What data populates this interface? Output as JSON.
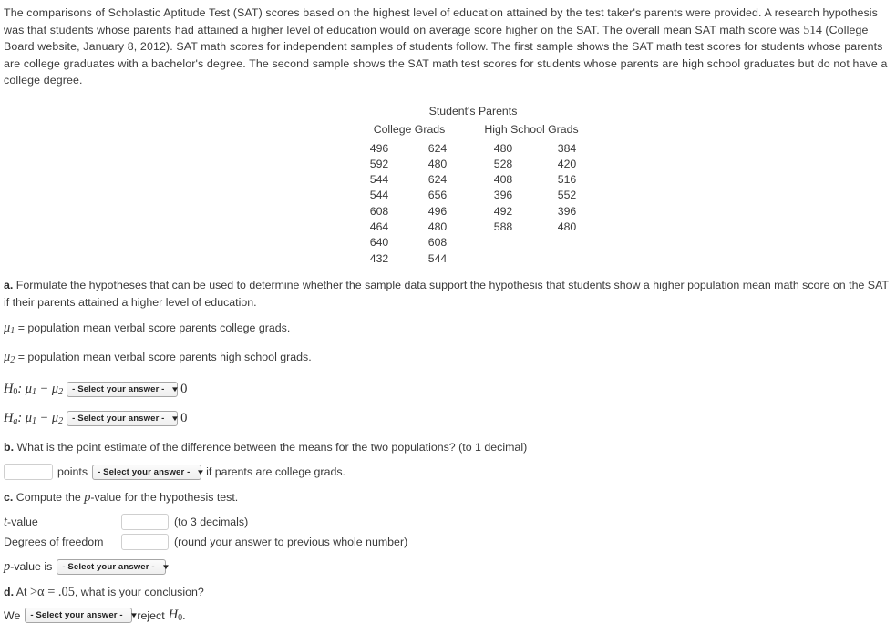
{
  "intro": {
    "part1": "The comparisons of Scholastic Aptitude Test (SAT) scores based on the highest level of education attained by the test taker's parents were provided. A research hypothesis was that students whose parents had attained a higher level of education would on average score higher on the SAT. The overall mean SAT math score was ",
    "mean_score": "514",
    "part2": " (College Board website, January 8, 2012). SAT math scores for independent samples of students follow. The first sample shows the SAT math test scores for students whose parents are college graduates with a bachelor's degree. The second sample shows the SAT math test scores for students whose parents are high school graduates but do not have a college degree."
  },
  "table": {
    "group_title": "Student's Parents",
    "headers": [
      "College Grads",
      "High School Grads"
    ],
    "rows": [
      [
        "496",
        "624",
        "480",
        "384"
      ],
      [
        "592",
        "480",
        "528",
        "420"
      ],
      [
        "544",
        "624",
        "408",
        "516"
      ],
      [
        "544",
        "656",
        "396",
        "552"
      ],
      [
        "608",
        "496",
        "492",
        "396"
      ],
      [
        "464",
        "480",
        "588",
        "480"
      ],
      [
        "640",
        "608",
        "",
        ""
      ],
      [
        "432",
        "544",
        "",
        ""
      ]
    ]
  },
  "part_a": {
    "label": "a.",
    "text": "Formulate the hypotheses that can be used to determine whether the sample data support the hypothesis that students show a higher population mean math score on the SAT if their parents attained a higher level of education.",
    "def1_mu": "μ",
    "def1_sub": "1",
    "def1_text": "= population mean verbal score parents college grads.",
    "def2_mu": "μ",
    "def2_sub": "2",
    "def2_text": "= population mean verbal score parents high school grads.",
    "h0_H": "H",
    "h0_sub": "0",
    "h0_expr": ": μ",
    "h0_s1": "1",
    "h0_minus": " − μ",
    "h0_s2": "2",
    "ha_H": "H",
    "ha_sub": "a",
    "zero": "0",
    "select_placeholder": "- Select your answer -",
    "caret": "▼"
  },
  "part_b": {
    "label": "b.",
    "text": "What is the point estimate of the difference between the means for the two populations? (to 1 decimal)",
    "input_value": "",
    "points_label": "points",
    "select_placeholder": "- Select your answer -",
    "tail_text": "if parents are college grads."
  },
  "part_c": {
    "label": "c.",
    "text_pre": "Compute the ",
    "p_italic": "p",
    "text_post": "-value for the hypothesis test.",
    "t_label_italic": "t",
    "t_label_rest": "-value",
    "t_value": "",
    "t_note": "(to 3 decimals)",
    "df_label": "Degrees of freedom",
    "df_value": "",
    "df_note": "(round your answer to previous whole number)",
    "pvalue_p": "p",
    "pvalue_rest": "-value is",
    "pvalue_select": "- Select your answer -"
  },
  "part_d": {
    "label": "d.",
    "text_pre": "At ",
    "math": ">α = .05",
    "text_post": ", what is your conclusion?",
    "we_label": "We",
    "select_placeholder": "- Select your answer -",
    "reject_label": "reject",
    "h0_H": "H",
    "h0_sub": "0",
    "period": "."
  },
  "colors": {
    "text": "#3a3a3a",
    "select_border": "#a6a6a6",
    "input_border": "#cfcfcf"
  }
}
